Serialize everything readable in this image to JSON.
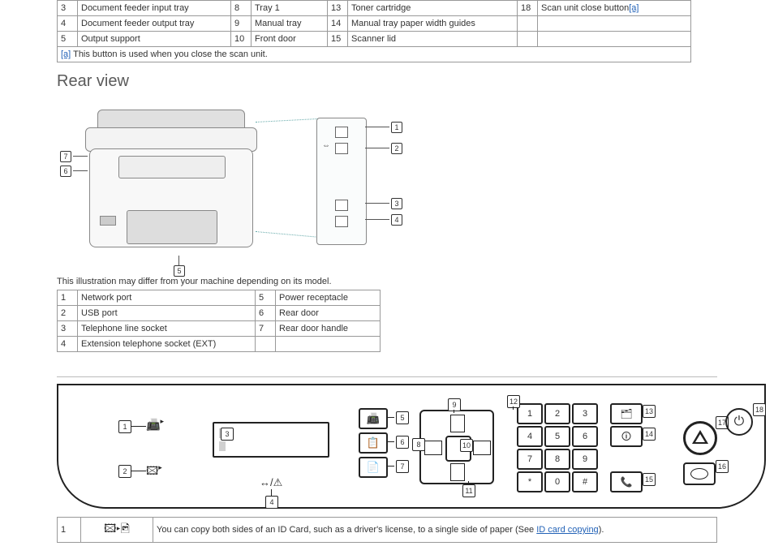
{
  "top_table": {
    "rows": [
      [
        "3",
        "Document feeder input tray",
        "8",
        "Tray 1",
        "13",
        "Toner cartridge",
        "18"
      ],
      [
        "4",
        "Document feeder output tray",
        "9",
        "Manual tray",
        "14",
        "Manual tray paper width guides",
        "",
        ""
      ],
      [
        "5",
        "Output support",
        "10",
        "Front door",
        "15",
        "Scanner lid",
        "",
        ""
      ]
    ],
    "cell18": "Scan unit close button",
    "footnote_marker": "[a]",
    "footnote": "This button is used when you close the scan unit."
  },
  "rear": {
    "title": "Rear view",
    "caption": "This illustration may differ from your machine depending on its model.",
    "table": {
      "rows": [
        [
          "1",
          "Network port",
          "5",
          "Power receptacle"
        ],
        [
          "2",
          "USB port",
          "6",
          "Rear door"
        ],
        [
          "3",
          "Telephone line socket",
          "7",
          "Rear door handle"
        ],
        [
          "4",
          "Extension telephone socket (EXT)",
          "",
          ""
        ]
      ]
    },
    "callouts": [
      "1",
      "2",
      "3",
      "4",
      "5",
      "6",
      "7"
    ]
  },
  "panel": {
    "callouts": [
      "1",
      "2",
      "3",
      "4",
      "5",
      "6",
      "7",
      "8",
      "9",
      "10",
      "11",
      "12",
      "13",
      "14",
      "15",
      "16",
      "17",
      "18"
    ],
    "keys": [
      "1",
      "2",
      "3",
      "4",
      "5",
      "6",
      "7",
      "8",
      "9",
      "*",
      "0",
      "#"
    ]
  },
  "footer": {
    "num": "1",
    "text_pre": "You can copy both sides of an ID Card, such as a driver's license, to a single side of paper (See ",
    "link": "ID card copying",
    "text_post": ")."
  }
}
